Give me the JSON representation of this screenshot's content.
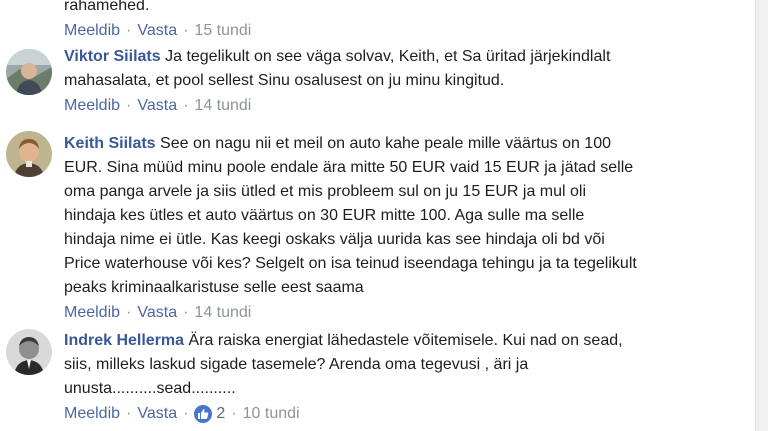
{
  "comments": [
    {
      "partial": true,
      "lines": [
        "rahamehed."
      ],
      "actions": {
        "like": "Meeldib",
        "reply": "Vasta",
        "time": "15 tundi"
      }
    },
    {
      "author": "Viktor Siilats",
      "lines": [
        "Ja tegelikult on see väga solvav, Keith, et Sa üritad järjekindlalt",
        "mahasalata, et pool sellest Sinu osalusest on ju minu kingitud."
      ],
      "actions": {
        "like": "Meeldib",
        "reply": "Vasta",
        "time": "14 tundi"
      }
    },
    {
      "author": "Keith Siilats",
      "lines": [
        "See on nagu nii et meil on auto kahe peale mille väärtus on 100",
        "EUR. Sina müüd minu poole endale ära mitte 50 EUR vaid 15 EUR ja jätad selle",
        "oma panga arvele ja siis ütled et mis probleem sul on ju 15 EUR ja mul oli",
        "hindaja kes ütles et auto väärtus on 30 EUR mitte 100. Aga sulle ma selle",
        "hindaja nime ei ütle. Kas keegi oskaks välja uurida kas see hindaja oli bd või",
        "Price waterhouse või kes? Selgelt on isa teinud iseendaga tehingu ja ta tegelikult",
        "peaks kriminaalkaristuse selle eest saama"
      ],
      "actions": {
        "like": "Meeldib",
        "reply": "Vasta",
        "time": "14 tundi"
      }
    },
    {
      "author": "Indrek Hellerma",
      "lines": [
        "Ära raiska energiat lähedastele võitemisele. Kui nad on sead,",
        "siis, milleks laskud sigade tasemele? Arenda oma tegevusi , äri ja",
        "unusta..........sead.........."
      ],
      "actions": {
        "like": "Meeldib",
        "reply": "Vasta",
        "reactions": "2",
        "time": "10 tundi"
      }
    }
  ],
  "icons": {
    "like_reaction": "thumbs-up-icon",
    "like_color": "#4a76c9"
  },
  "colors": {
    "author": "#385898",
    "text": "#1c1e21",
    "action": "#4b67a1",
    "meta": "#8d949e"
  }
}
